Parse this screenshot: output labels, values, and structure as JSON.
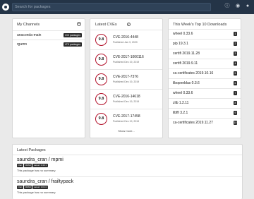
{
  "topbar": {
    "search_placeholder": "Search for packages",
    "icons": [
      "anaconda-logo-icon",
      "info-icon",
      "github-icon",
      "user-icon"
    ]
  },
  "channels": {
    "title": "My Channels",
    "items": [
      {
        "name": "anaconda-main",
        "badge": "13K packages"
      },
      {
        "name": "rgumn",
        "badge": "47K packages"
      }
    ]
  },
  "cves": {
    "title": "Latest CVEs",
    "score_color": "#b3122b",
    "items": [
      {
        "score": "9.8",
        "id": "CVE-2016-4448",
        "published": "Published Jan 3, 2020"
      },
      {
        "score": "9.8",
        "id": "CVE-2017-1000116",
        "published": "Published Dec 19, 2019"
      },
      {
        "score": "9.8",
        "id": "CVE-2017-7376",
        "published": "Published Dec 19, 2019"
      },
      {
        "score": "9.8",
        "id": "CVE-2016-14618",
        "published": "Published Dec 19, 2019"
      },
      {
        "score": "9.8",
        "id": "CVE-2017-17458",
        "published": "Published Dec 19, 2019"
      }
    ],
    "show_more": "Show more..."
  },
  "downloads": {
    "title": "This Week's Top 10 Downloads",
    "items": [
      {
        "name": "wheel 0.33.6",
        "rank": "1"
      },
      {
        "name": "pip 19.3.1",
        "rank": "2"
      },
      {
        "name": "certifi 2019.11.28",
        "rank": "3"
      },
      {
        "name": "certifi 2019.9.11",
        "rank": "4"
      },
      {
        "name": "ca-certificates 2019.10.16",
        "rank": "5"
      },
      {
        "name": "libopenblas 0.3.6",
        "rank": "6"
      },
      {
        "name": "wheel 0.33.6",
        "rank": "7"
      },
      {
        "name": "zlib 1.2.11",
        "rank": "8"
      },
      {
        "name": "libffi 3.2.1",
        "rank": "9"
      },
      {
        "name": "ca-certificates 2019.11.27",
        "rank": "10"
      }
    ]
  },
  "latest": {
    "title": "Latest Packages",
    "packages": [
      {
        "name": "saundra_cran / mpmi",
        "tags": [
          "cran",
          "CRAN",
          "Latest: 0.43.1"
        ],
        "summary": "This package has no summary."
      },
      {
        "name": "saundra_cran / frailtypack",
        "tags": [
          "cran",
          "CRAN",
          "Latest: 3.0.3.1"
        ],
        "summary": "This package has no summary."
      }
    ]
  }
}
